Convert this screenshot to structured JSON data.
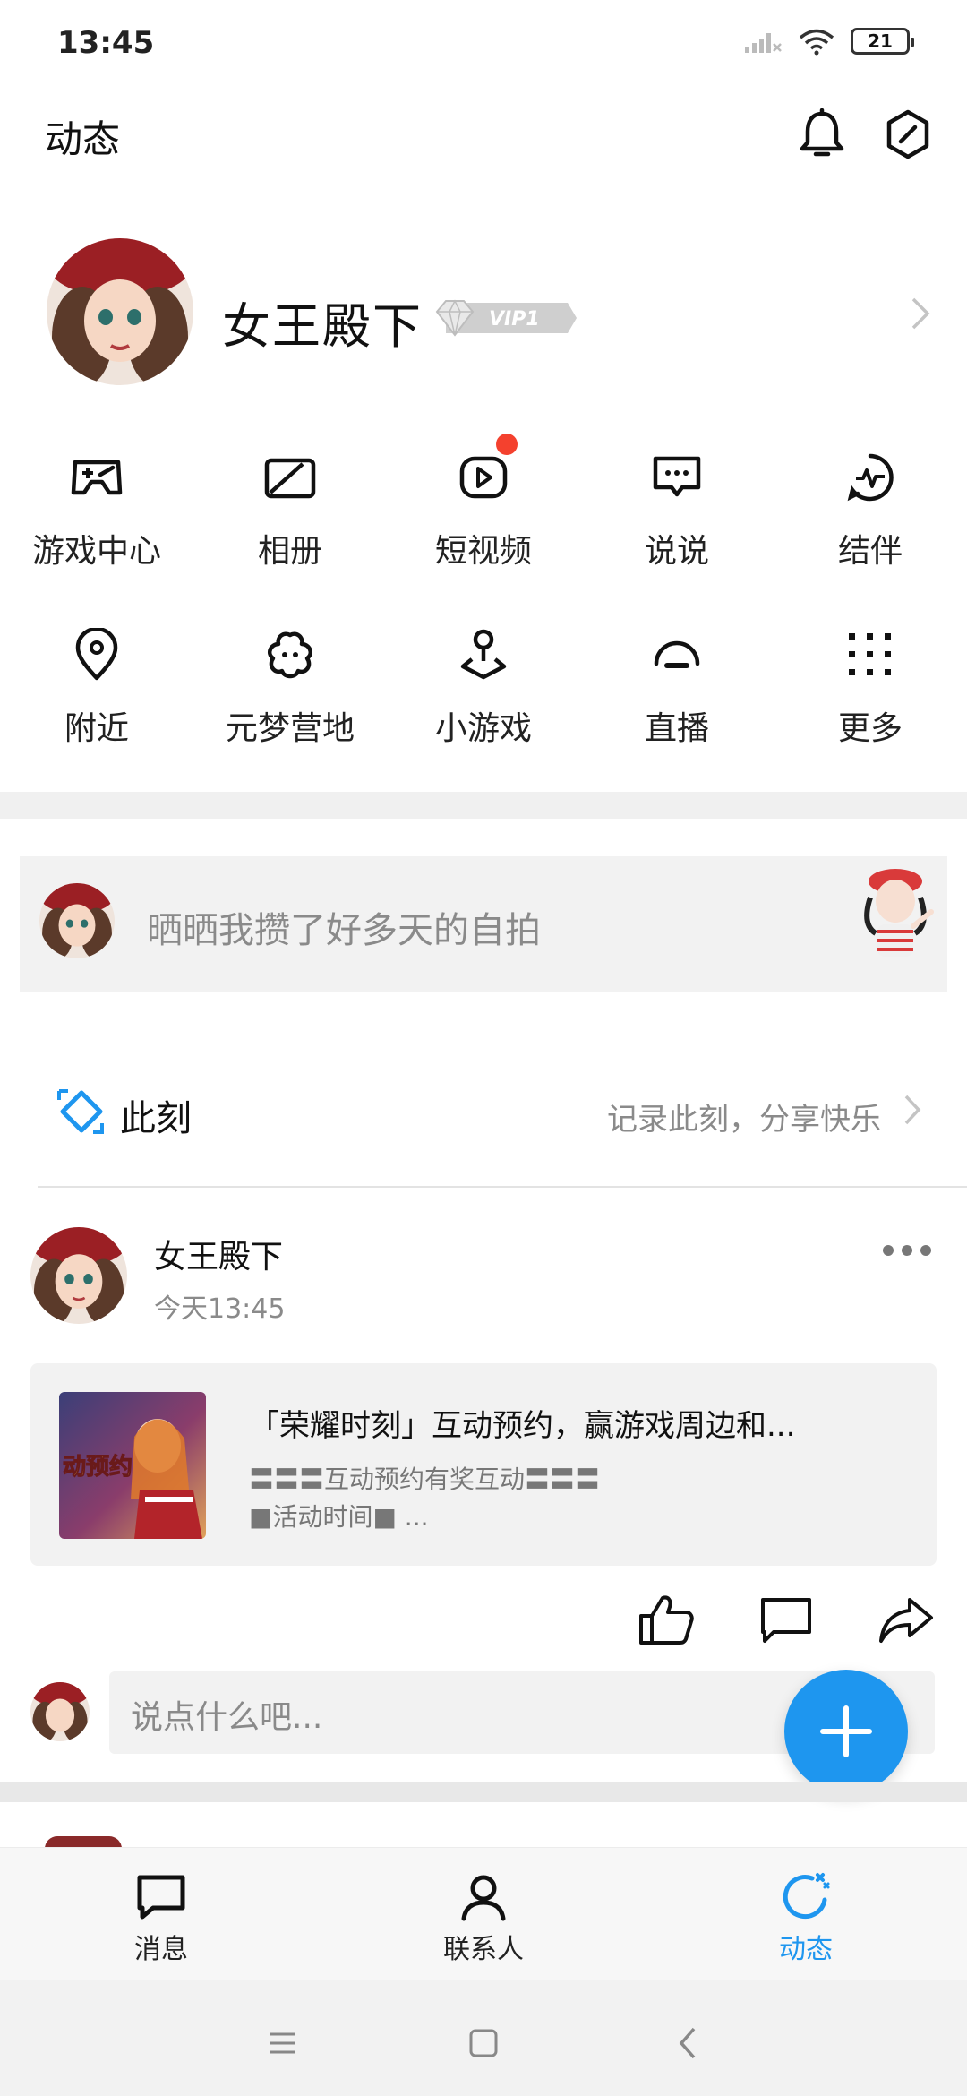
{
  "status_bar": {
    "time": "13:45",
    "battery": "21"
  },
  "header": {
    "title": "动态"
  },
  "profile": {
    "name": "女王殿下",
    "vip_label": "VIP1"
  },
  "features": [
    {
      "label": "游戏中心",
      "icon": "gamepad-icon"
    },
    {
      "label": "相册",
      "icon": "album-icon"
    },
    {
      "label": "短视频",
      "icon": "short-video-icon"
    },
    {
      "label": "说说",
      "icon": "chat-bubble-icon"
    },
    {
      "label": "结伴",
      "icon": "pulse-icon"
    },
    {
      "label": "附近",
      "icon": "location-pin-icon"
    },
    {
      "label": "元梦营地",
      "icon": "flower-icon"
    },
    {
      "label": "小游戏",
      "icon": "joystick-icon"
    },
    {
      "label": "直播",
      "icon": "live-icon"
    },
    {
      "label": "更多",
      "icon": "grid-dots-icon"
    }
  ],
  "composer": {
    "prompt": "晒晒我攒了好多天的自拍"
  },
  "moment": {
    "title": "此刻",
    "hint": "记录此刻，分享快乐"
  },
  "post": {
    "author": "女王殿下",
    "time": "今天13:45",
    "share_title": "「荣耀时刻」互动预约，赢游戏周边和...",
    "share_desc1": "〓〓〓互动预约有奖互动〓〓〓",
    "share_desc2": "■活动时间■ ...",
    "thumb_text": "动预约"
  },
  "comment": {
    "placeholder": "说点什么吧..."
  },
  "bottom_nav": [
    {
      "label": "消息",
      "active": false
    },
    {
      "label": "联系人",
      "active": false
    },
    {
      "label": "动态",
      "active": true
    }
  ],
  "colors": {
    "accent": "#1e96ef",
    "badge_red": "#f4412e",
    "panel_gray": "#f2f2f2"
  }
}
